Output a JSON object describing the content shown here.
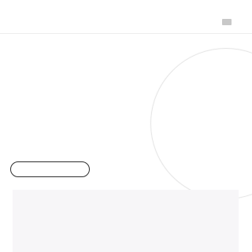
{
  "theme": {
    "background": "#ffffff",
    "divider": "#ededed",
    "menu_icon": "#c8c8c8",
    "circle_outline": "#e6e6e6",
    "pill_border": "#2f2f2f",
    "panel_fill": "#f7f6f8"
  },
  "header": {
    "menu_icon_name": "menu-icon"
  },
  "decor": {
    "circle_icon_name": "decorative-circle"
  },
  "buttons": {
    "outline_pill_label": ""
  }
}
